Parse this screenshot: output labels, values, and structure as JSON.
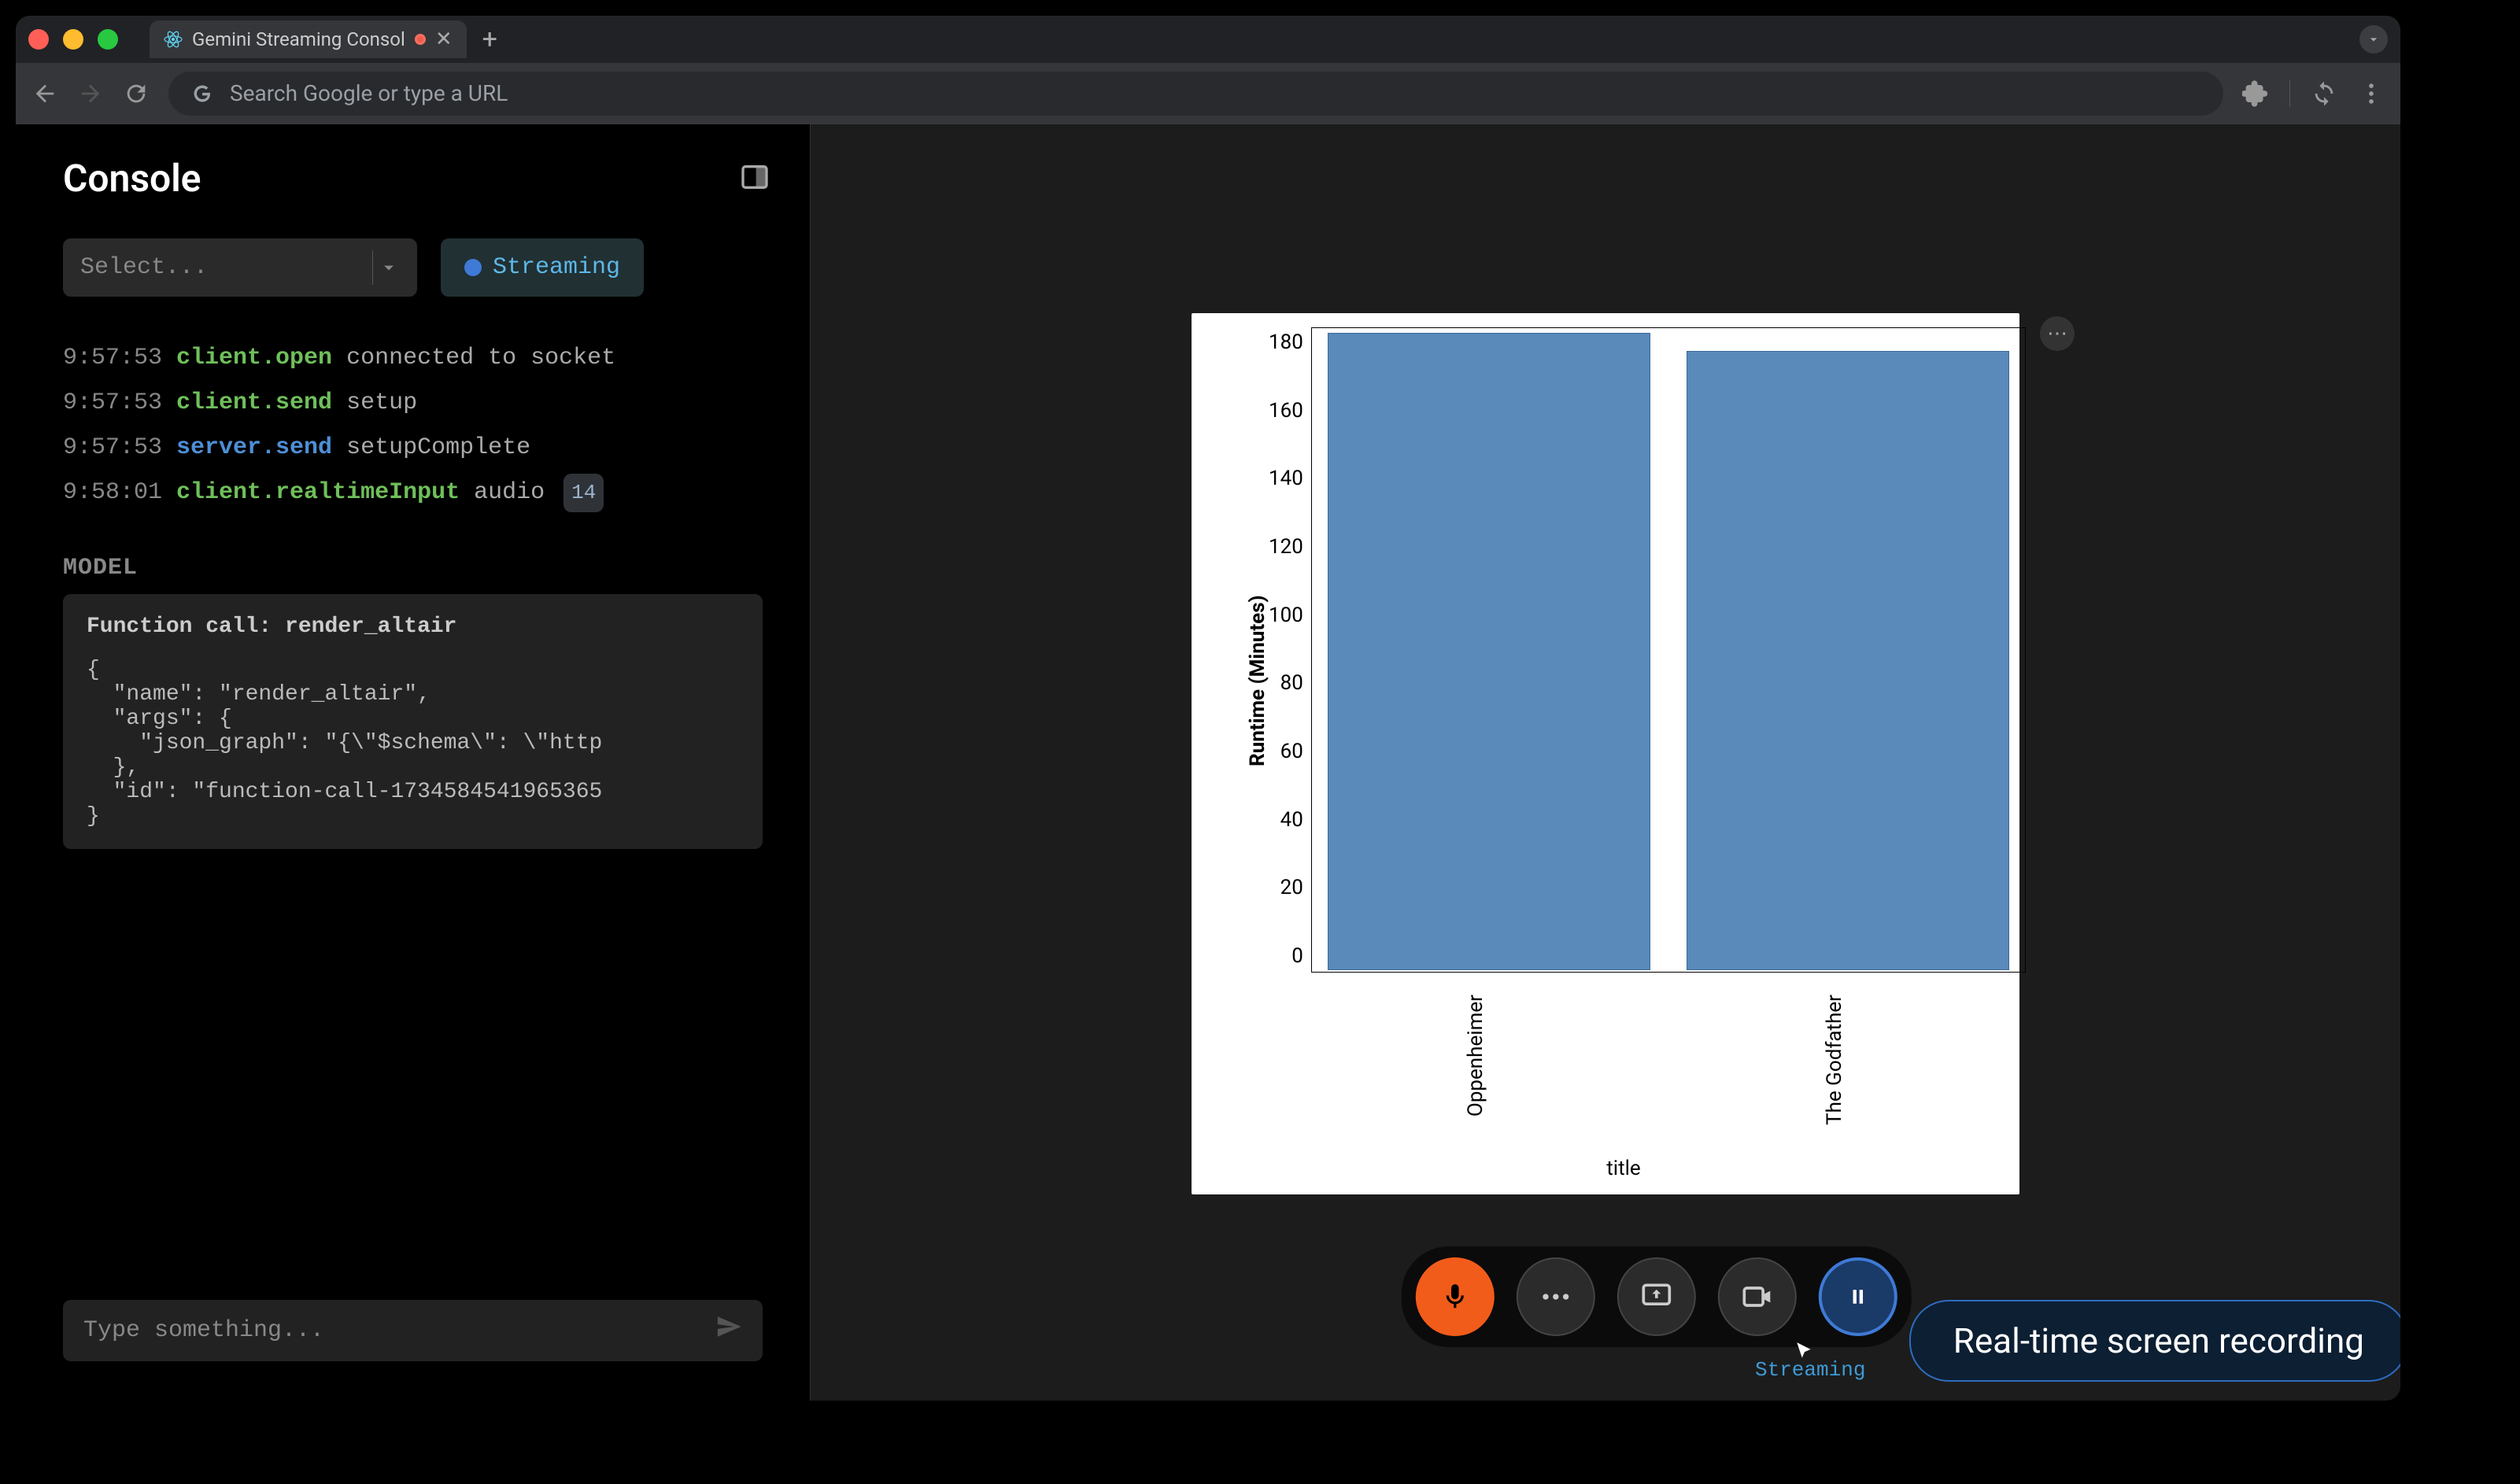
{
  "browser": {
    "tab_title": "Gemini Streaming Consol",
    "url_placeholder": "Search Google or type a URL"
  },
  "sidebar": {
    "title": "Console",
    "select_placeholder": "Select...",
    "status_label": "Streaming",
    "model_label": "MODEL",
    "func_head": "Function call: render_altair",
    "func_body": "{\n  \"name\": \"render_altair\",\n  \"args\": {\n    \"json_graph\": \"{\\\"$schema\\\": \\\"http\n  },\n  \"id\": \"function-call-1734584541965365\n}",
    "input_placeholder": "Type something..."
  },
  "log": [
    {
      "time": "9:57:53",
      "event": "client.open",
      "event_color": "green",
      "rest": "connected to socket"
    },
    {
      "time": "9:57:53",
      "event": "client.send",
      "event_color": "green",
      "rest": "setup"
    },
    {
      "time": "9:57:53",
      "event": "server.send",
      "event_color": "blue",
      "rest": "setupComplete"
    },
    {
      "time": "9:58:01",
      "event": "client.realtimeInput",
      "event_color": "green",
      "rest": "audio",
      "badge": "14"
    }
  ],
  "chart_data": {
    "type": "bar",
    "categories": [
      "Oppenheimer",
      "The Godfather"
    ],
    "values": [
      180,
      175
    ],
    "xlabel": "title",
    "ylabel": "Runtime (Minutes)",
    "ylim": [
      0,
      180
    ],
    "yticks": [
      0,
      20,
      40,
      60,
      80,
      100,
      120,
      140,
      160,
      180
    ]
  },
  "streaming_label": "Streaming",
  "banner": "Real-time screen recording"
}
